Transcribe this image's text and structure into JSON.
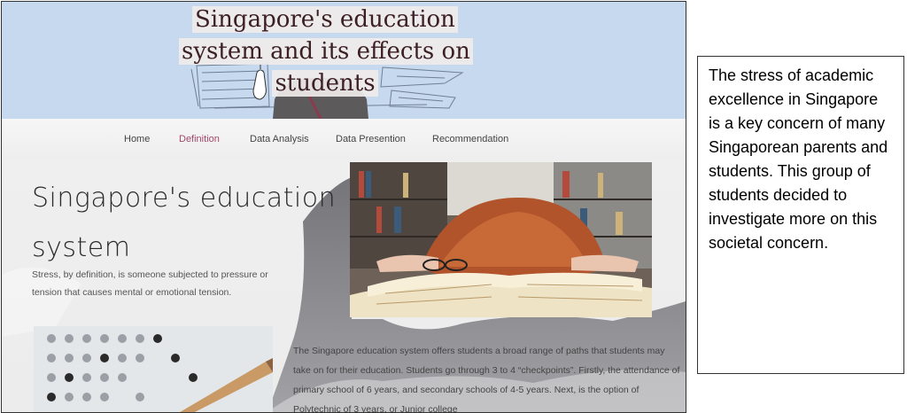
{
  "header": {
    "title": "Singapore's education system and its effects on students"
  },
  "nav": {
    "items": [
      {
        "label": "Home"
      },
      {
        "label": "Definition",
        "active": true
      },
      {
        "label": "Data Analysis"
      },
      {
        "label": "Data Presention"
      },
      {
        "label": "Recommendation"
      }
    ]
  },
  "main": {
    "title": "Singapore's education system",
    "definition": "Stress, by definition, is someone subjected to pressure or tension that causes mental or emotional tension.",
    "body": "The Singapore education system offers students a broad range of paths that students may take on for their education. Students go through 3 to 4 “checkpoints”. Firstly, the attendance of primary school of 6 years, and secondary schools of 4-5 years. Next, is the option of Polytechnic of 3 years, or Junior college"
  },
  "callout": {
    "text": "The stress of academic excellence in Singapore is a key concern of many Singaporean parents and students. This group of students decided to investigate more on this societal concern."
  },
  "colors": {
    "header_bg": "#c6d9ef",
    "accent": "#a0496a",
    "title_text": "#3b1f23"
  }
}
